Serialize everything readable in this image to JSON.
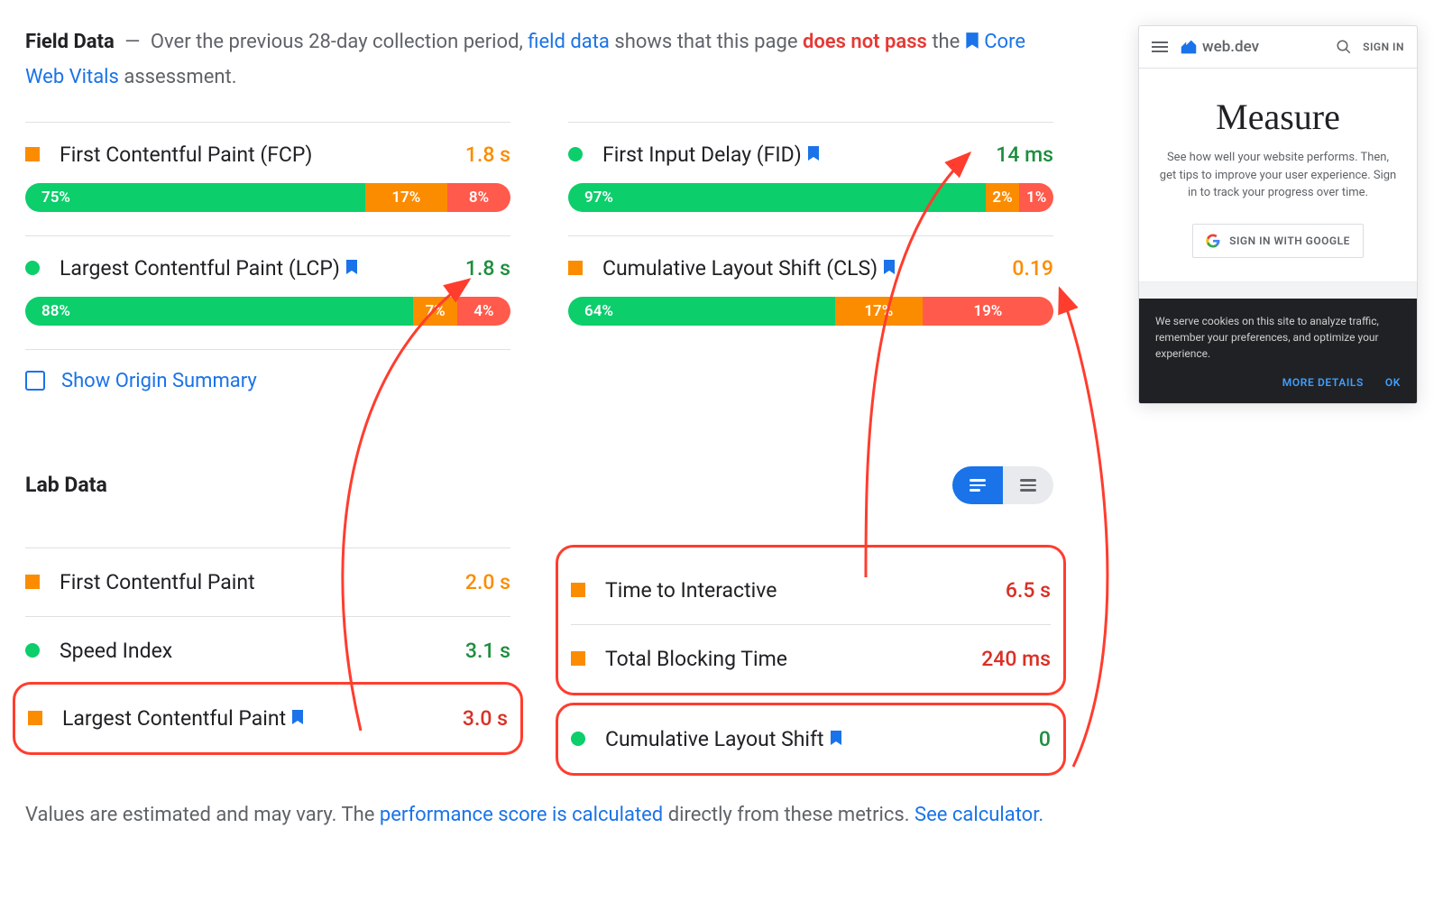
{
  "intro": {
    "title": "Field Data",
    "text1": "Over the previous 28-day collection period,",
    "fieldDataLink": "field data",
    "text2": "shows that this page",
    "failPhrase": "does not pass",
    "text3": "the",
    "cwvLink": "Core Web Vitals",
    "assessment": "assessment."
  },
  "fieldMetrics": {
    "fcp": {
      "name": "First Contentful Paint (FCP)",
      "value": "1.8 s",
      "status": "orange",
      "bar": {
        "g": "75%",
        "gw": 70,
        "o": "17%",
        "ow": 17,
        "r": "8%",
        "rw": 13
      }
    },
    "lcp": {
      "name": "Largest Contentful Paint (LCP)",
      "value": "1.8 s",
      "status": "green",
      "hasBookmark": true,
      "bar": {
        "g": "88%",
        "gw": 80,
        "o": "7%",
        "ow": 9,
        "r": "4%",
        "rw": 11
      }
    },
    "fid": {
      "name": "First Input Delay (FID)",
      "value": "14 ms",
      "status": "green",
      "hasBookmark": true,
      "bar": {
        "g": "97%",
        "gw": 86,
        "o": "2%",
        "ow": 7,
        "r": "1%",
        "rw": 7
      }
    },
    "cls": {
      "name": "Cumulative Layout Shift (CLS)",
      "value": "0.19",
      "status": "orange",
      "hasBookmark": true,
      "bar": {
        "g": "64%",
        "gw": 55,
        "o": "17%",
        "ow": 18,
        "r": "19%",
        "rw": 27
      }
    }
  },
  "originSummary": "Show Origin Summary",
  "labTitle": "Lab Data",
  "labMetrics": {
    "fcp": {
      "name": "First Contentful Paint",
      "value": "2.0 s",
      "status": "orange",
      "color": "orange"
    },
    "si": {
      "name": "Speed Index",
      "value": "3.1 s",
      "status": "green",
      "color": "green"
    },
    "lcp": {
      "name": "Largest Contentful Paint",
      "value": "3.0 s",
      "status": "orange",
      "color": "red",
      "bookmark": true,
      "highlight": true
    },
    "tti": {
      "name": "Time to Interactive",
      "value": "6.5 s",
      "status": "orange",
      "color": "red",
      "highlight": true
    },
    "tbt": {
      "name": "Total Blocking Time",
      "value": "240 ms",
      "status": "orange",
      "color": "red",
      "highlight": true
    },
    "cls": {
      "name": "Cumulative Layout Shift",
      "value": "0",
      "status": "green",
      "color": "green",
      "bookmark": true,
      "highlight": true
    }
  },
  "footnote": {
    "t1": "Values are estimated and may vary. The",
    "link1": "performance score is calculated",
    "t2": "directly from these metrics.",
    "link2": "See calculator."
  },
  "phone": {
    "brand": "web.dev",
    "signIn": "SIGN IN",
    "heading": "Measure",
    "desc": "See how well your website performs. Then, get tips to improve your user experience. Sign in to track your progress over time.",
    "signInGoogle": "SIGN IN WITH GOOGLE",
    "cookieText": "We serve cookies on this site to analyze traffic, remember your preferences, and optimize your experience.",
    "moreDetails": "MORE DETAILS",
    "ok": "OK"
  }
}
